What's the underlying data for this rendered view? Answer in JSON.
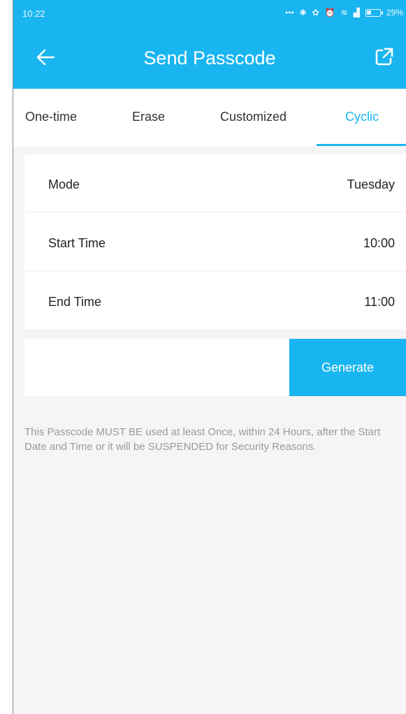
{
  "status_bar": {
    "time": "10:22",
    "battery_text": "29%"
  },
  "header": {
    "title": "Send Passcode",
    "back_icon": "arrow-left-icon",
    "share_icon": "external-link-icon"
  },
  "tabs": [
    {
      "label": "One-time"
    },
    {
      "label": "Erase"
    },
    {
      "label": "Customized"
    },
    {
      "label": "Cyclic"
    }
  ],
  "active_tab": "Cyclic",
  "settings": [
    {
      "label": "Mode",
      "value": "Tuesday"
    },
    {
      "label": "Start Time",
      "value": "10:00"
    },
    {
      "label": "End Time",
      "value": "11:00"
    }
  ],
  "generate_label": "Generate",
  "notice": "This Passcode MUST BE used at least Once, within 24 Hours, after the Start Date and Time or it will be SUSPENDED for Security Reasons.",
  "colors": {
    "accent": "#19b5f0",
    "background": "#f5f5f5",
    "text": "#222222",
    "muted": "#9a9a9a"
  }
}
